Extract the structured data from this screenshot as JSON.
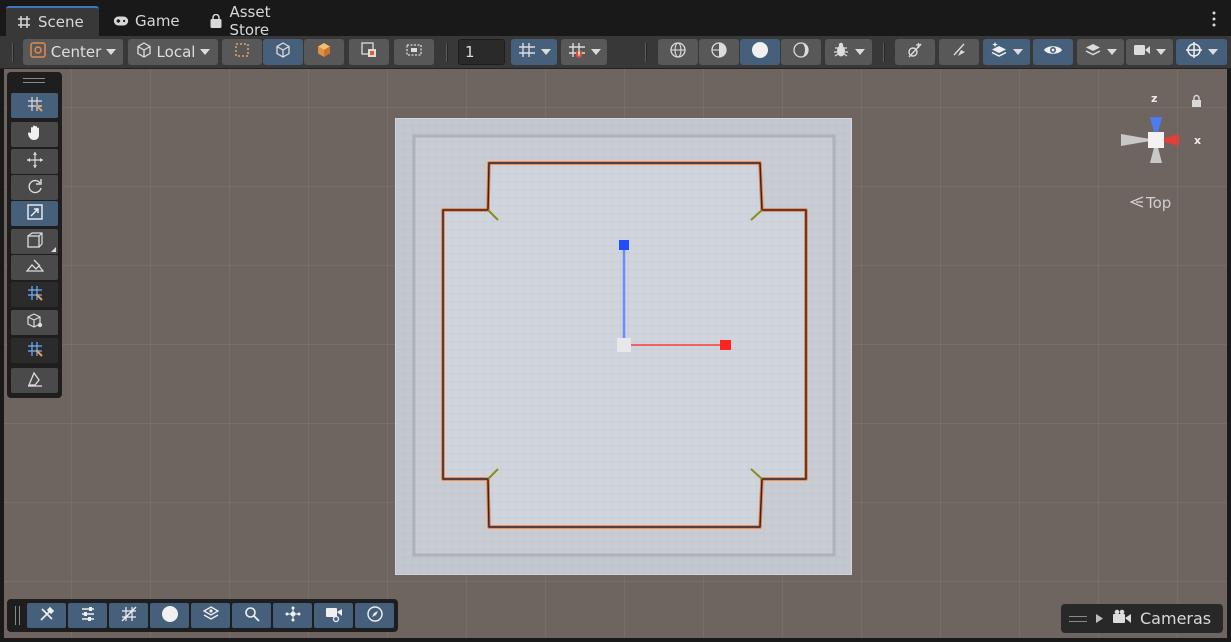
{
  "tabs": [
    {
      "label": "Scene",
      "icon": "grid-icon",
      "active": true
    },
    {
      "label": "Game",
      "icon": "gamepad-icon",
      "active": false
    },
    {
      "label": "Asset Store",
      "icon": "shopping-bag-icon",
      "active": false
    }
  ],
  "toolbar": {
    "pivot_label": "Center",
    "space_label": "Local",
    "grid_snap_value": "1"
  },
  "gizmo": {
    "view_label": "Top",
    "axis_z": "z",
    "axis_x": "x",
    "colors": {
      "x": "#e0403a",
      "z": "#4d7cf0",
      "y": "#c8c8c8"
    }
  },
  "overlays": {
    "cameras_label": "Cameras"
  },
  "colors": {
    "accent": "#46607c",
    "viewport_bg": "#6e6560",
    "selection_outline": "#ff7a2a",
    "handle_x": "#ff2222",
    "handle_y": "#1f4fff"
  }
}
